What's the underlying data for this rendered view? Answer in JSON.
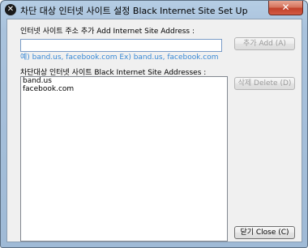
{
  "window": {
    "title": "차단 대상 인터넷 사이트 설정 Black Internet Site Set Up",
    "close_glyph": "✕",
    "app_icon": "block-icon",
    "app_icon_glyph": "✕"
  },
  "add_section": {
    "label": "인터넷 사이트 주소 추가 Add Internet Site Address :",
    "input_value": "",
    "hint": "예) band.us, facebook.com Ex) band.us, facebook.com",
    "add_button_label": "추가 Add (A)",
    "add_button_enabled": false
  },
  "list_section": {
    "label": "차단대상 인터넷 사이트 Black Internet Site Addresses :",
    "items": [
      "band.us",
      "facebook.com"
    ],
    "delete_button_label": "삭제 Delete (D)",
    "delete_button_enabled": false
  },
  "footer": {
    "close_button_label": "닫기 Close (C)"
  },
  "colors": {
    "hint": "#3a8ad6",
    "disabled_text": "#9a9a9a",
    "title_bar": "#a9c2dc",
    "close_button": "#c2412b"
  }
}
